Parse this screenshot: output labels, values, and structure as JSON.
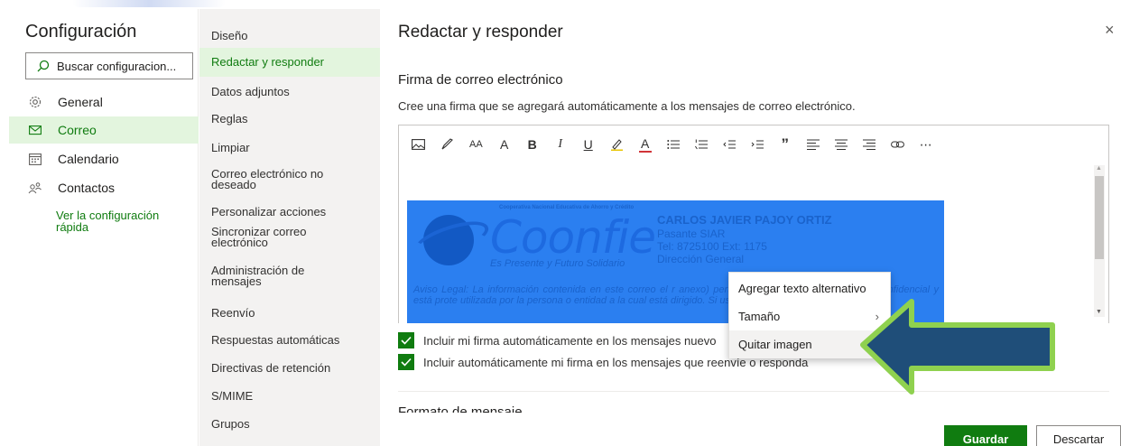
{
  "settings": {
    "title": "Configuración",
    "search_placeholder": "Buscar configuracion...",
    "nav": [
      {
        "label": "General",
        "icon": "gear-icon"
      },
      {
        "label": "Correo",
        "icon": "mail-icon",
        "active": true
      },
      {
        "label": "Calendario",
        "icon": "calendar-icon"
      },
      {
        "label": "Contactos",
        "icon": "people-icon"
      }
    ],
    "quick_settings_link": "Ver la configuración rápida"
  },
  "submenu": {
    "items": [
      "Diseño",
      "Redactar y responder",
      "Datos adjuntos",
      "Reglas",
      "Limpiar",
      "Correo electrónico no deseado",
      "Personalizar acciones",
      "Sincronizar correo electrónico",
      "Administración de mensajes",
      "Reenvío",
      "Respuestas automáticas",
      "Directivas de retención",
      "S/MIME",
      "Grupos"
    ],
    "active_index": 1
  },
  "panel": {
    "title": "Redactar y responder",
    "close_glyph": "×",
    "signature_title": "Firma de correo electrónico",
    "signature_desc": "Cree una firma que se agregará automáticamente a los mensajes de correo electrónico.",
    "toolbar_icons": [
      "insert-image-icon",
      "format-painter-icon",
      "font-size-icon",
      "grow-font-icon",
      "bold-icon",
      "italic-icon",
      "underline-icon",
      "highlight-icon",
      "font-color-icon",
      "bullets-icon",
      "numbering-icon",
      "decrease-indent-icon",
      "increase-indent-icon",
      "quote-icon",
      "align-left-icon",
      "align-center-icon",
      "align-right-icon",
      "link-icon",
      "more-icon"
    ],
    "toolbar_glyphs": {
      "font_size": "AA",
      "grow_font": "A",
      "bold": "B",
      "italic": "I",
      "underline": "U",
      "font_color": "A",
      "quote": "”",
      "more": "⋯"
    },
    "signature_image": {
      "org_line": "Cooperativa Nacional Educativa de Ahorro y Crédito",
      "logo_text": "Coonfie",
      "tagline": "Es Presente y Futuro Solidario",
      "name": "CARLOS JAVIER PAJOY ORTIZ",
      "role": "Pasante SIAR",
      "phone": "Tel: 8725100 Ext: 1175",
      "department": "Dirección General",
      "legal": "Aviso Legal: La información contenida en este correo el                              r anexo) pertenece a Coonfie, tiene carácter confidencial y está prote                               utilizada por la persona o entidad a la cual está dirigido. Si usted no e                                 recibe"
    },
    "checkbox_new": "Incluir mi firma automáticamente en los mensajes nuevo",
    "checkbox_reply": "Incluir automáticamente mi firma en los mensajes que reenvíe o responda",
    "next_section_partial": "Formato de mensaje",
    "save_label": "Guardar",
    "discard_label": "Descartar"
  },
  "context_menu": {
    "items": [
      "Agregar texto alternativo",
      "Tamaño",
      "Quitar imagen"
    ],
    "submenu_chevron": "›",
    "highlighted_index": 2
  },
  "colors": {
    "accent": "#107c10",
    "accent_light": "#e3f5de",
    "signature_bg": "#2b7ff0",
    "arrow_fill": "#1f4e79",
    "arrow_border": "#8fd14f"
  }
}
